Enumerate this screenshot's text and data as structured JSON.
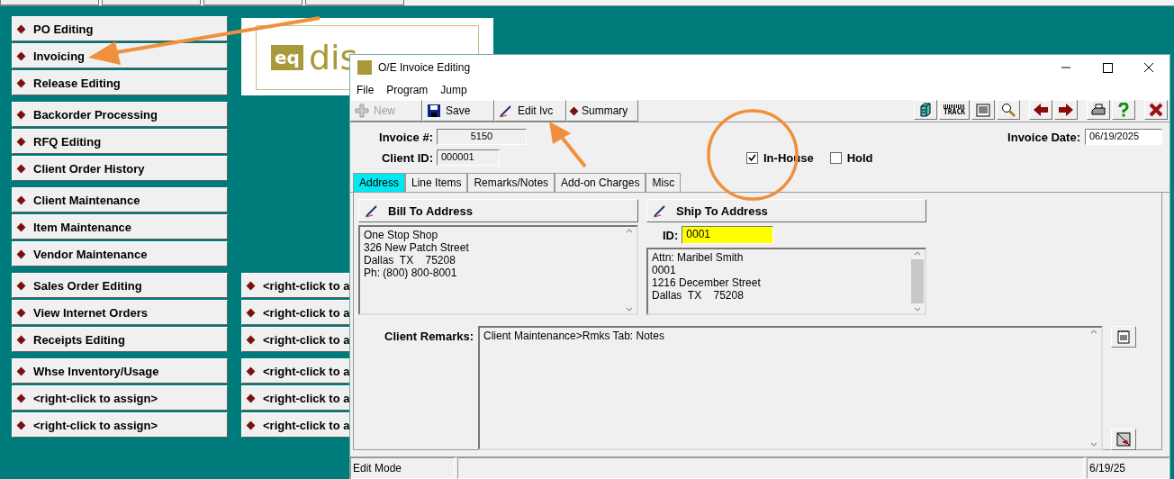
{
  "shortcuts": {
    "left_groups": [
      [
        "PO Editing",
        "Invoicing",
        "Release Editing"
      ],
      [
        "Backorder Processing",
        "RFQ Editing",
        "Client Order History"
      ],
      [
        "Client Maintenance",
        "Item Maintenance",
        "Vendor Maintenance"
      ],
      [
        "Sales Order Editing",
        "View Internet Orders",
        "Receipts Editing"
      ],
      [
        "Whse Inventory/Usage",
        "<right-click to assign>",
        "<right-click to assign>"
      ]
    ],
    "logo": {
      "badge": "eq",
      "word": "dis"
    },
    "right_groups": [
      [
        "<right-click to a",
        "<right-click to a",
        "<right-click to a"
      ],
      [
        "<right-click to a",
        "<right-click to a",
        "<right-click to a"
      ]
    ]
  },
  "invoice_window": {
    "title": "O/E Invoice Editing",
    "menu": [
      "File",
      "Program",
      "Jump"
    ],
    "toolbar": [
      {
        "label": "New",
        "disabled": true
      },
      {
        "label": "Save",
        "disabled": false
      },
      {
        "label": "Edit Ivc",
        "disabled": false
      },
      {
        "label": "Summary",
        "disabled": false
      }
    ],
    "tools": [
      {
        "kind": "cabinet"
      },
      {
        "kind": "track",
        "label": "TRACK"
      },
      {
        "kind": "document"
      },
      {
        "kind": "magnifier"
      },
      {
        "kind": "back"
      },
      {
        "kind": "forward"
      },
      {
        "kind": "printer"
      },
      {
        "kind": "help"
      },
      {
        "kind": "close"
      }
    ],
    "invoice_no": {
      "label": "Invoice #:",
      "value": "5150"
    },
    "client_id": {
      "label": "Client ID:",
      "value": "000001"
    },
    "invoice_date": {
      "label": "Invoice Date:",
      "value": "06/19/2025"
    },
    "flags": [
      {
        "label": "In-House",
        "checked": true
      },
      {
        "label": "Hold",
        "checked": false
      }
    ],
    "tabs": [
      {
        "label": "Address",
        "selected": true
      },
      {
        "label": "Line Items",
        "selected": false
      },
      {
        "label": "Remarks/Notes",
        "selected": false
      },
      {
        "label": "Add-on Charges",
        "selected": false
      },
      {
        "label": "Misc",
        "selected": false
      }
    ],
    "bill_to": {
      "title": "Bill To Address",
      "lines": [
        "One Stop Shop",
        "326 New Patch Street",
        "Dallas  TX    75208",
        "Ph: (800) 800-8001"
      ]
    },
    "ship_to": {
      "title": "Ship To Address",
      "id_label": "ID:",
      "id_value": "0001",
      "lines": [
        "Attn: Maribel Smith",
        "0001",
        "1216 December Street",
        "Dallas  TX    75208"
      ]
    },
    "client_remarks": {
      "label": "Client Remarks:",
      "text": "Client Maintenance>Rmks Tab: Notes"
    },
    "status_bar": {
      "mode": "Edit Mode",
      "date": "6/19/25"
    }
  }
}
